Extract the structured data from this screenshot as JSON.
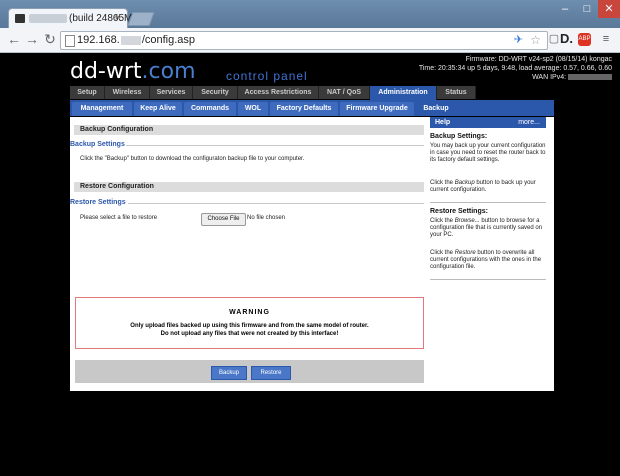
{
  "browser": {
    "tab_title": "(build 24865M",
    "tab_close": "×",
    "url_host": "192.168.",
    "url_path": "/config.asp",
    "window_min": "–",
    "window_max": "□",
    "window_close": "✕",
    "back": "←",
    "forward": "→",
    "reload": "↻",
    "ext_d": "D.",
    "ext_abp": "ABP",
    "menu": "≡"
  },
  "router": {
    "logo_text": "dd-wrt",
    "logo_suffix": ".com",
    "control_panel": "control panel",
    "firmware": "Firmware: DD-WRT v24-sp2 (08/15/14) kongac",
    "time": "Time: 20:35:34 up 5 days, 9:48, load average: 0.57, 0.66, 0.60",
    "wan": "WAN IPv4:"
  },
  "main_tabs": [
    {
      "label": "Setup"
    },
    {
      "label": "Wireless"
    },
    {
      "label": "Services"
    },
    {
      "label": "Security"
    },
    {
      "label": "Access Restrictions"
    },
    {
      "label": "NAT / QoS"
    },
    {
      "label": "Administration"
    },
    {
      "label": "Status"
    }
  ],
  "sub_tabs": [
    {
      "label": "Management"
    },
    {
      "label": "Keep Alive"
    },
    {
      "label": "Commands"
    },
    {
      "label": "WOL"
    },
    {
      "label": "Factory Defaults"
    },
    {
      "label": "Firmware Upgrade"
    },
    {
      "label": "Backup"
    }
  ],
  "backup": {
    "section_title": "Backup Configuration",
    "legend": "Backup Settings",
    "text": "Click the \"Backup\" button to download the configuraton backup file to your computer."
  },
  "restore": {
    "section_title": "Restore Configuration",
    "legend": "Restore Settings",
    "label": "Please select a file to restore",
    "choose_button": "Choose File",
    "no_file": "No file chosen"
  },
  "warning": {
    "title": "WARNING",
    "line1": "Only upload files backed up using this firmware and from the same model of router.",
    "line2": "Do not upload any files that were not created by this interface!"
  },
  "buttons": {
    "backup": "Backup",
    "restore": "Restore"
  },
  "help": {
    "title": "Help",
    "more": "more...",
    "backup_title": "Backup Settings:",
    "backup_p1": "You may back up your current configuration in case you need to reset the router back to its factory default settings.",
    "backup_p2_a": "Click the ",
    "backup_p2_em": "Backup",
    "backup_p2_b": " button to back up your current configuration.",
    "restore_title": "Restore Settings:",
    "restore_p1_a": "Click the ",
    "restore_p1_em": "Browse...",
    "restore_p1_b": " button to browse for a configuration file that is currently saved on your PC.",
    "restore_p2_a": "Click the ",
    "restore_p2_em": "Restore",
    "restore_p2_b": " button to overwrite all current configurations with the ones in the configuration file."
  }
}
